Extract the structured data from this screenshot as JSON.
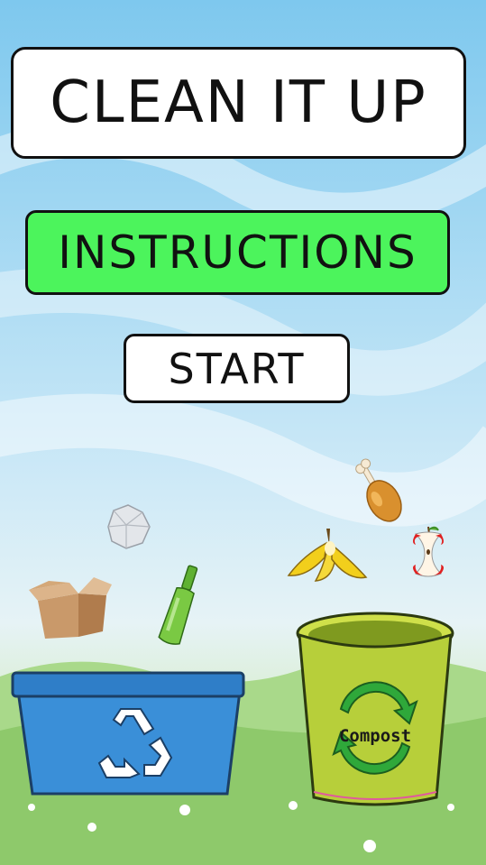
{
  "title": "CLEAN IT UP",
  "buttons": {
    "instructions": "INSTRUCTIONS",
    "start": "START"
  },
  "items": [
    "paper-ball",
    "cardboard-box",
    "glass-bottle",
    "banana-peel",
    "chicken-drumstick",
    "apple-core"
  ],
  "bins": {
    "compost_label": "Compost"
  },
  "colors": {
    "sky": "#8fd0f0",
    "grass": "#9ccf7a",
    "instructions_button": "#4cf45c",
    "recycle_bin": "#3a8fd8",
    "compost_bin": "#b7cf3a"
  }
}
